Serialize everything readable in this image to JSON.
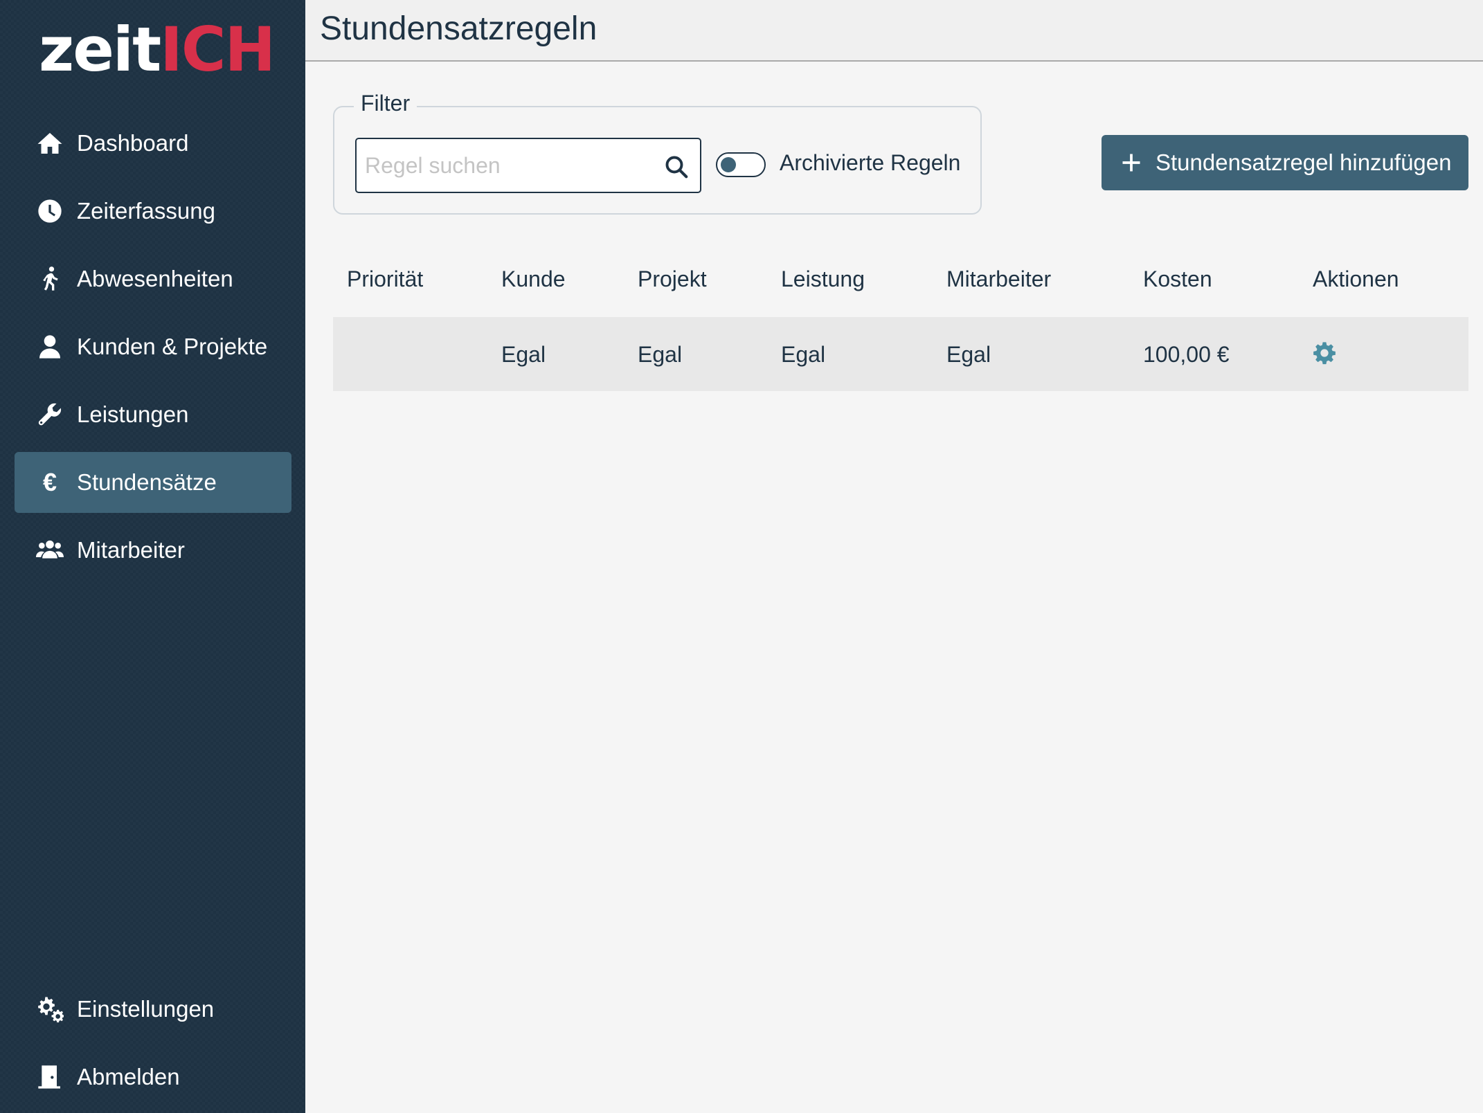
{
  "sidebar": {
    "logo": {
      "part1": "zeit",
      "part2": "ICH"
    },
    "items": [
      {
        "label": "Dashboard",
        "icon": "home-icon"
      },
      {
        "label": "Zeiterfassung",
        "icon": "clock-icon"
      },
      {
        "label": "Abwesenheiten",
        "icon": "walking-icon"
      },
      {
        "label": "Kunden & Projekte",
        "icon": "user-icon"
      },
      {
        "label": "Leistungen",
        "icon": "wrench-icon"
      },
      {
        "label": "Stundensätze",
        "icon": "euro-icon",
        "active": true
      },
      {
        "label": "Mitarbeiter",
        "icon": "users-icon"
      }
    ],
    "bottom_items": [
      {
        "label": "Einstellungen",
        "icon": "cogs-icon"
      },
      {
        "label": "Abmelden",
        "icon": "door-icon"
      }
    ]
  },
  "header": {
    "title": "Stundensatzregeln"
  },
  "filter": {
    "legend": "Filter",
    "search_placeholder": "Regel suchen",
    "search_value": "",
    "toggle_label": "Archivierte Regeln",
    "toggle_on": false
  },
  "actions": {
    "add_label": "Stundensatzregel hinzufügen"
  },
  "table": {
    "columns": [
      "Priorität",
      "Kunde",
      "Projekt",
      "Leistung",
      "Mitarbeiter",
      "Kosten",
      "Aktionen"
    ],
    "rows": [
      {
        "prioritaet": "",
        "kunde": "Egal",
        "projekt": "Egal",
        "leistung": "Egal",
        "mitarbeiter": "Egal",
        "kosten": "100,00 €"
      }
    ]
  },
  "colors": {
    "sidebar_bg": "#1e3243",
    "accent": "#3e6377",
    "logo_red": "#d8304a",
    "gear_icon": "#4a8fa3"
  }
}
